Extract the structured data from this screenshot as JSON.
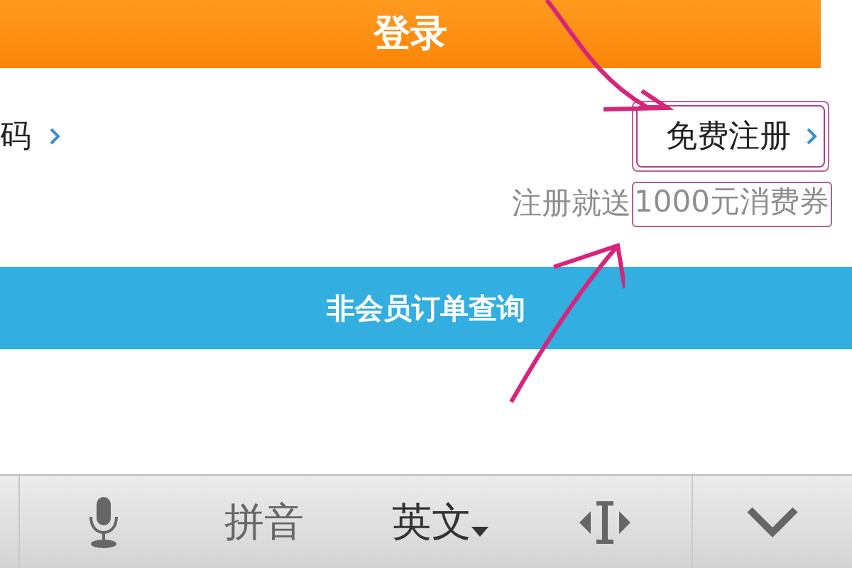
{
  "login_button": {
    "label": "登录"
  },
  "links": {
    "left": {
      "label": "码"
    },
    "register": {
      "label": "免费注册"
    }
  },
  "promo": {
    "text": "注册就送",
    "highlight": "1000元消费券"
  },
  "guest_query_button": {
    "label": "非会员订单查询"
  },
  "keyboard_bar": {
    "items": [
      {
        "kind": "mic"
      },
      {
        "kind": "text",
        "label": "拼音"
      },
      {
        "kind": "dropdown",
        "label": "英文"
      },
      {
        "kind": "cursor"
      },
      {
        "kind": "collapse"
      }
    ]
  }
}
